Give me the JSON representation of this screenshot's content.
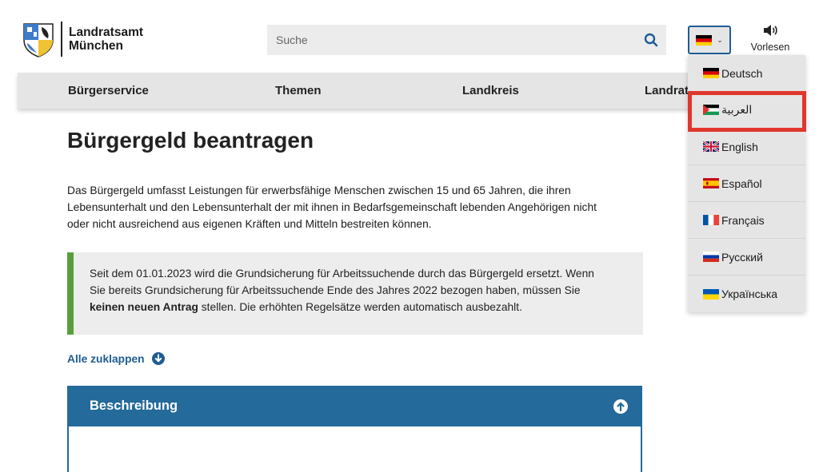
{
  "header": {
    "logo_line1": "Landratsamt",
    "logo_line2": "München",
    "search_placeholder": "Suche",
    "vorlesen_label": "Vorlesen"
  },
  "nav": {
    "items": [
      "Bürgerservice",
      "Themen",
      "Landkreis",
      "Landrat"
    ]
  },
  "main": {
    "title": "Bürgergeld beantragen",
    "intro_line1": "Das Bürgergeld umfasst Leistungen für erwerbsfähige Menschen zwischen 15 und 65 Jahren,  die ihren",
    "intro_line2": "Lebensunterhalt und den Lebensunterhalt der mit ihnen in Bedarfsgemeinschaft lebenden Angehörigen nicht",
    "intro_line3": "oder nicht ausreichend aus eigenen Kräften und Mitteln bestreiten können.",
    "notice_line1": "Seit dem 01.01.2023 wird die Grundsicherung für Arbeitssuchende durch das Bürgergeld ersetzt. Wenn",
    "notice_line2": "Sie bereits Grundsicherung für Arbeitssuchende Ende des Jahres 2022 bezogen haben, müssen Sie",
    "notice_bold": "keinen neuen Antrag",
    "notice_rest": " stellen. Die erhöhten Regelsätze werden automatisch ausbezahlt.",
    "collapse_all_label": "Alle zuklappen",
    "accordion_title": "Beschreibung"
  },
  "language_menu": {
    "selected": "Deutsch",
    "highlighted": "العربية",
    "items": [
      {
        "label": "Deutsch",
        "flag": "flag-de-icon"
      },
      {
        "label": "العربية",
        "flag": "flag-arabic-icon"
      },
      {
        "label": "English",
        "flag": "flag-uk-icon"
      },
      {
        "label": "Español",
        "flag": "flag-es-icon"
      },
      {
        "label": "Français",
        "flag": "flag-fr-icon"
      },
      {
        "label": "Русский",
        "flag": "flag-ru-icon"
      },
      {
        "label": "Українська",
        "flag": "flag-ua-icon"
      }
    ]
  },
  "colors": {
    "accent_blue": "#246a9a",
    "link_blue": "#1f5c94",
    "notice_green": "#5a9e3b",
    "highlight_red": "#e0362d",
    "nav_gray": "#e5e5e5"
  },
  "icons": [
    "bavarian-crest-icon",
    "search-icon",
    "chevron-down-icon",
    "speaker-icon",
    "arrow-down-circle-icon",
    "arrow-up-circle-icon"
  ]
}
